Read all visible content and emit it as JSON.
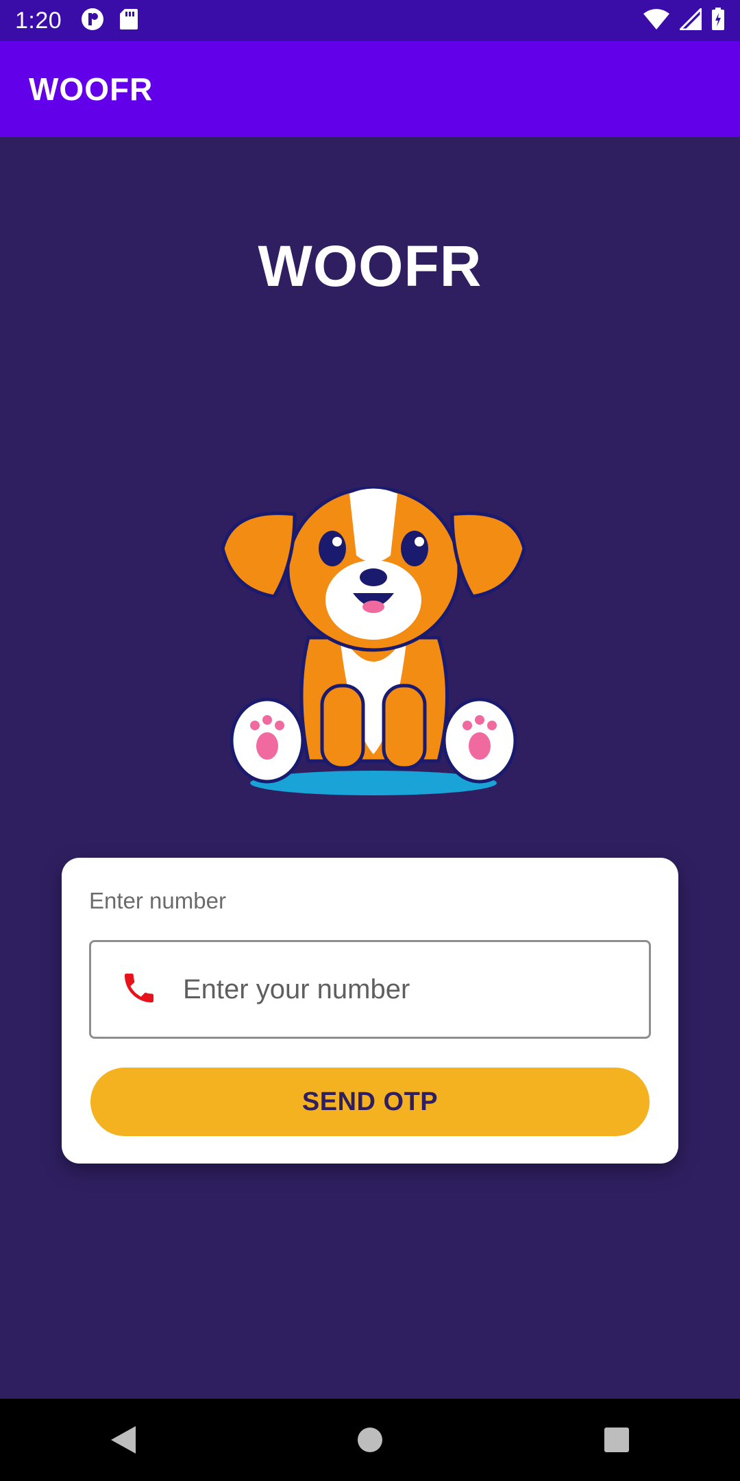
{
  "status_bar": {
    "time": "1:20",
    "left_icons": [
      "notification-icon",
      "sd-card-icon"
    ],
    "right_icons": [
      "wifi-icon",
      "cell-signal-icon",
      "battery-icon"
    ]
  },
  "app_bar": {
    "title": "WOOFR"
  },
  "hero": {
    "title": "WOOFR",
    "illustration": "dog-mascot-illustration"
  },
  "login_card": {
    "label": "Enter number",
    "phone_field": {
      "icon": "phone-icon",
      "placeholder": "Enter your number",
      "value": ""
    },
    "button_label": "SEND OTP"
  },
  "nav_bar": {
    "items": [
      "back-icon",
      "home-icon",
      "recents-icon"
    ]
  },
  "colors": {
    "status_bar": "#3a0ca8",
    "app_bar": "#6200ea",
    "background": "#2f1f61",
    "button": "#f4b120",
    "phone_icon": "#e8121b"
  }
}
